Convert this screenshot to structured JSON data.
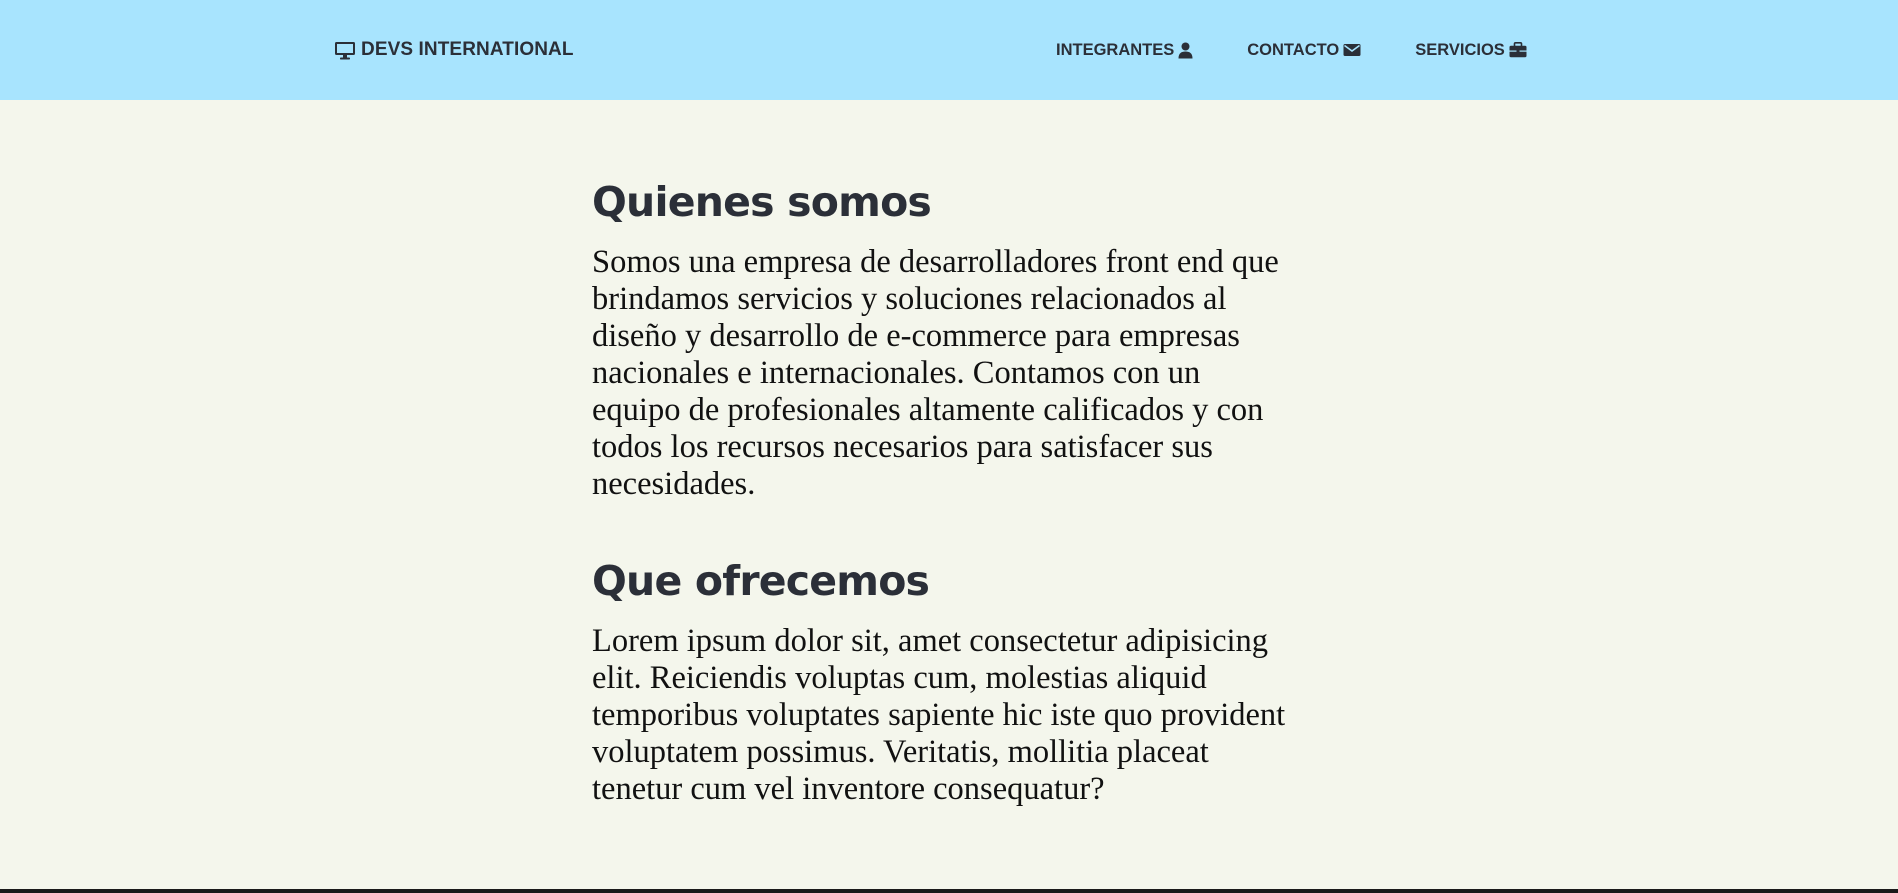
{
  "navbar": {
    "brand": "DEVS INTERNATIONAL",
    "brand_icon": "desktop-icon",
    "items": [
      {
        "label": "INTEGRANTES",
        "icon": "user-icon"
      },
      {
        "label": "CONTACTO",
        "icon": "envelope-icon"
      },
      {
        "label": "SERVICIOS",
        "icon": "briefcase-icon"
      }
    ]
  },
  "sections": [
    {
      "title": "Quienes somos",
      "text": "Somos una empresa de desarrolladores front end que brindamos servicios y soluciones relacionados al diseño y desarrollo de e-commerce para empresas nacionales e internacionales. Contamos con un equipo de profesionales altamente calificados y con todos los recursos necesarios para satisfacer sus necesidades."
    },
    {
      "title": "Que ofrecemos",
      "text": "Lorem ipsum dolor sit, amet consectetur adipisicing elit. Reiciendis voluptas cum, molestias aliquid temporibus voluptates sapiente hic iste quo provident voluptatem possimus. Veritatis, mollitia placeat tenetur cum vel inventore consequatur?"
    }
  ],
  "colors": {
    "navbar_bg": "#a8e4fe",
    "page_bg": "#f4f6ec",
    "heading": "#2b2f38",
    "text": "#111111"
  }
}
